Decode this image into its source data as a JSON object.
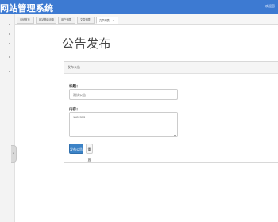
{
  "app": {
    "title": "网站管理系统",
    "welcome": "欢迎您"
  },
  "tabs": [
    {
      "label": "系统首页"
    },
    {
      "label": "网站基础设置"
    },
    {
      "label": "用户列表"
    },
    {
      "label": "文章列表"
    },
    {
      "label": "文章列表"
    }
  ],
  "page": {
    "title": "公告发布"
  },
  "form": {
    "panel_title": "发布公告",
    "title_label": "标题：",
    "title_value": "测试公告",
    "content_label": "内容：",
    "content_value": "1122333",
    "submit_label": "发布公告",
    "reset_label": "重置"
  }
}
